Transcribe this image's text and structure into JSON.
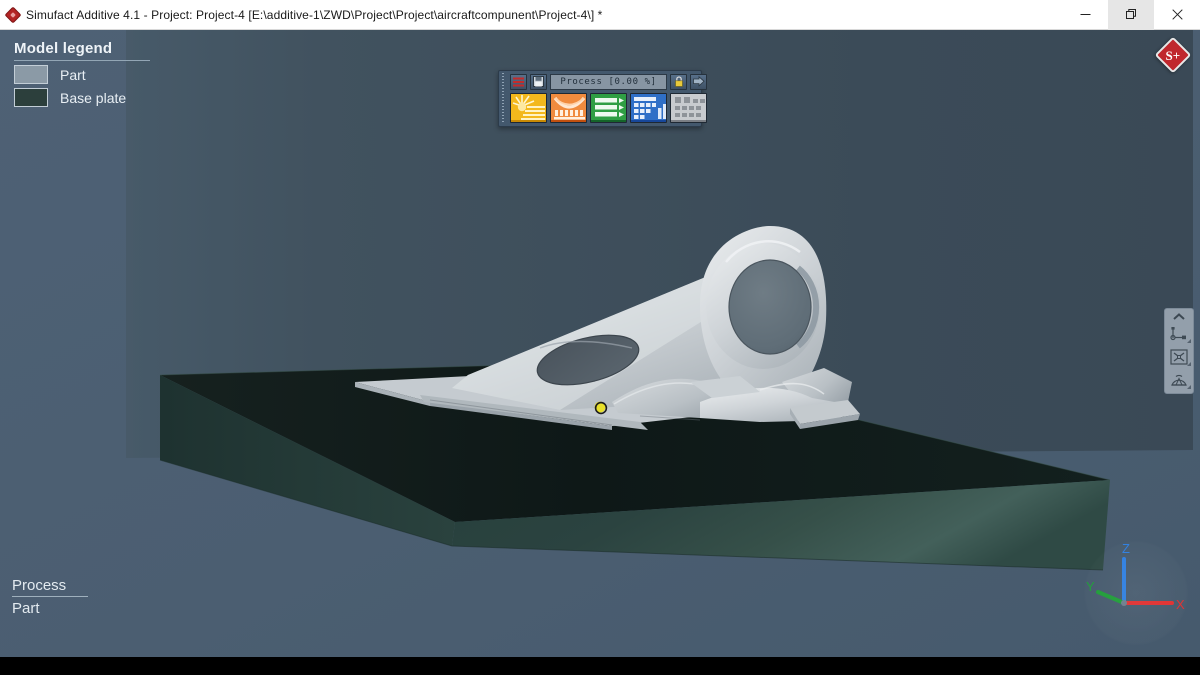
{
  "window": {
    "title": "Simufact Additive 4.1 - Project: Project-4 [E:\\additive-1\\ZWD\\Project\\Project\\aircraftcompunent\\Project-4\\] *",
    "app_icon": "simufact-diamond-icon",
    "controls": {
      "minimize": "minimize-icon",
      "maximize": "restore-icon",
      "close": "close-icon"
    }
  },
  "legend": {
    "title": "Model legend",
    "items": [
      {
        "label": "Part",
        "color": "#8b9aa6"
      },
      {
        "label": "Base plate",
        "color": "#2c3f3c"
      }
    ]
  },
  "status_stack": {
    "process": "Process",
    "part": "Part"
  },
  "badge": {
    "text": "S+",
    "color": "#c0272d"
  },
  "process_toolbar": {
    "menu_icon": "hamburger-menu-icon",
    "save_icon": "save-floppy-icon",
    "process_field": "Process  [0.00 %]",
    "lock_icon": "lock-icon",
    "export_icon": "forward-arrow-icon",
    "stages": [
      {
        "name": "stage-build",
        "icon": "sun-burst-icon",
        "color": "#f0b429",
        "underline": "#d48a06"
      },
      {
        "name": "stage-distortion",
        "icon": "arc-curve-icon",
        "color": "#ef8a3d",
        "underline": "#c75514"
      },
      {
        "name": "stage-results",
        "icon": "green-bars-icon",
        "color": "#2f9e44",
        "underline": "#18702b"
      },
      {
        "name": "stage-table",
        "icon": "blue-table-icon",
        "color": "#2f6fc7",
        "underline": "#17479a"
      },
      {
        "name": "stage-grid",
        "icon": "gray-grid-icon",
        "color": "#b9bcc0",
        "underline": "#7b7f85"
      }
    ]
  },
  "view_tools": {
    "collapse_icon": "chevron-up-icon",
    "items": [
      {
        "name": "measure-tool",
        "icon": "ruler-measure-icon"
      },
      {
        "name": "fit-to-screen-tool",
        "icon": "zoom-extents-icon"
      },
      {
        "name": "rotate-view-tool",
        "icon": "protractor-rotate-icon"
      }
    ]
  },
  "axis_triad": {
    "x": {
      "label": "X",
      "color": "#e03030"
    },
    "y": {
      "label": "Y",
      "color": "#1f9d38"
    },
    "z": {
      "label": "Z",
      "color": "#2f7fe0"
    }
  },
  "viewport": {
    "background": "#4c6074",
    "backdrop": "#3c4d5c",
    "part_color": "#c9ced2",
    "base_plate_color": "#2d403d",
    "marker": {
      "name": "selection-point-marker",
      "color": "#e8e02a"
    }
  }
}
